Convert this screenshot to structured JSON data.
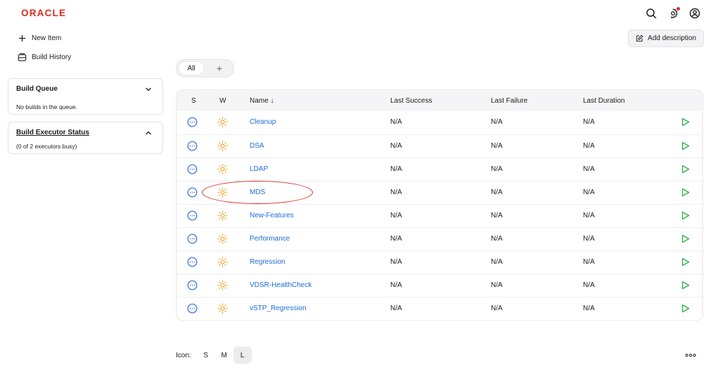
{
  "header": {
    "logo_text": "ORACLE",
    "icons": [
      "search-icon",
      "gear-icon",
      "user-icon"
    ]
  },
  "sidebar": {
    "links": [
      {
        "label": "New Item",
        "icon": "plus-icon"
      },
      {
        "label": "Build History",
        "icon": "history-icon"
      }
    ],
    "build_queue": {
      "title": "Build Queue",
      "body": "No builds in the queue."
    },
    "executor_status": {
      "title": "Build Executor Status",
      "body": "(0 of 2 executors busy)"
    }
  },
  "toolbar": {
    "add_description_label": "Add description"
  },
  "tabs": {
    "all_label": "All",
    "add_label": "+"
  },
  "table": {
    "headers": {
      "s": "S",
      "w": "W",
      "name": "Name ↓",
      "last_success": "Last Success",
      "last_failure": "Last Failure",
      "last_duration": "Last Duration"
    },
    "rows": [
      {
        "name": "Cleanup",
        "last_success": "N/A",
        "last_failure": "N/A",
        "last_duration": "N/A"
      },
      {
        "name": "DSA",
        "last_success": "N/A",
        "last_failure": "N/A",
        "last_duration": "N/A"
      },
      {
        "name": "LDAP",
        "last_success": "N/A",
        "last_failure": "N/A",
        "last_duration": "N/A"
      },
      {
        "name": "MDS",
        "last_success": "N/A",
        "last_failure": "N/A",
        "last_duration": "N/A"
      },
      {
        "name": "New-Features",
        "last_success": "N/A",
        "last_failure": "N/A",
        "last_duration": "N/A"
      },
      {
        "name": "Performance",
        "last_success": "N/A",
        "last_failure": "N/A",
        "last_duration": "N/A"
      },
      {
        "name": "Regression",
        "last_success": "N/A",
        "last_failure": "N/A",
        "last_duration": "N/A"
      },
      {
        "name": "VDSR-HealthCheck",
        "last_success": "N/A",
        "last_failure": "N/A",
        "last_duration": "N/A"
      },
      {
        "name": "vSTP_Regression",
        "last_success": "N/A",
        "last_failure": "N/A",
        "last_duration": "N/A"
      }
    ]
  },
  "footer": {
    "icon_label": "Icon:",
    "sizes": [
      "S",
      "M",
      "L"
    ],
    "active_size": "L"
  },
  "colors": {
    "brand": "#e0291f",
    "link": "#1b6bd8",
    "status_icon": "#2f6fd6",
    "weather_icon": "#f0a020",
    "play_icon": "#2bb34a",
    "annotation": "#d8302a"
  }
}
